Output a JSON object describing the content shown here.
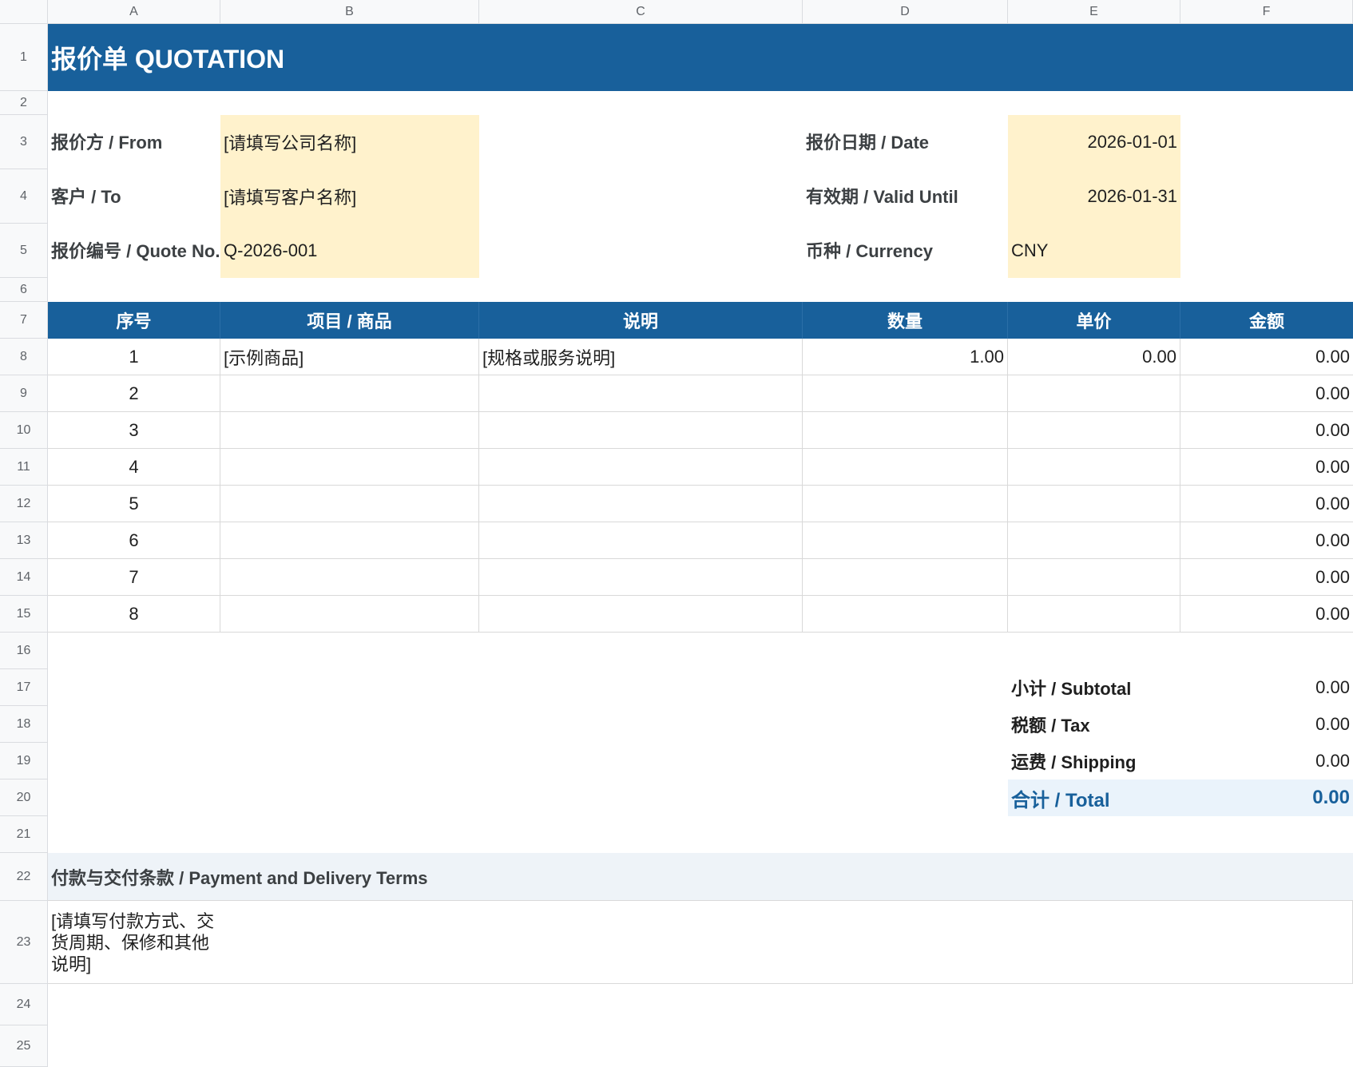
{
  "columns": [
    "A",
    "B",
    "C",
    "D",
    "E",
    "F"
  ],
  "rows": [
    "1",
    "2",
    "3",
    "4",
    "5",
    "6",
    "7",
    "8",
    "9",
    "10",
    "11",
    "12",
    "13",
    "14",
    "15",
    "16",
    "17",
    "18",
    "19",
    "20",
    "21",
    "22",
    "23",
    "24",
    "25"
  ],
  "title": "报价单 QUOTATION",
  "info": {
    "from_label": "报价方 / From",
    "from_value": "[请填写公司名称]",
    "to_label": "客户 / To",
    "to_value": "[请填写客户名称]",
    "quote_no_label": "报价编号 / Quote No.",
    "quote_no_value": "Q-2026-001",
    "date_label": "报价日期 / Date",
    "date_value": "2026-01-01",
    "valid_label": "有效期 / Valid Until",
    "valid_value": "2026-01-31",
    "currency_label": "币种 / Currency",
    "currency_value": "CNY"
  },
  "table": {
    "headers": [
      "序号",
      "项目 / 商品",
      "说明",
      "数量",
      "单价",
      "金额"
    ],
    "rows": [
      {
        "no": "1",
        "item": "[示例商品]",
        "desc": "[规格或服务说明]",
        "qty": "1.00",
        "price": "0.00",
        "amount": "0.00"
      },
      {
        "no": "2",
        "item": "",
        "desc": "",
        "qty": "",
        "price": "",
        "amount": "0.00"
      },
      {
        "no": "3",
        "item": "",
        "desc": "",
        "qty": "",
        "price": "",
        "amount": "0.00"
      },
      {
        "no": "4",
        "item": "",
        "desc": "",
        "qty": "",
        "price": "",
        "amount": "0.00"
      },
      {
        "no": "5",
        "item": "",
        "desc": "",
        "qty": "",
        "price": "",
        "amount": "0.00"
      },
      {
        "no": "6",
        "item": "",
        "desc": "",
        "qty": "",
        "price": "",
        "amount": "0.00"
      },
      {
        "no": "7",
        "item": "",
        "desc": "",
        "qty": "",
        "price": "",
        "amount": "0.00"
      },
      {
        "no": "8",
        "item": "",
        "desc": "",
        "qty": "",
        "price": "",
        "amount": "0.00"
      }
    ]
  },
  "summary": {
    "subtotal_label": "小计 / Subtotal",
    "subtotal_value": "0.00",
    "tax_label": "税额 / Tax",
    "tax_value": "0.00",
    "shipping_label": "运费 / Shipping",
    "shipping_value": "0.00",
    "total_label": "合计 / Total",
    "total_value": "0.00"
  },
  "terms": {
    "label": "付款与交付条款 / Payment and Delivery Terms",
    "body": "[请填写付款方式、交\n货周期、保修和其他\n说明]"
  },
  "colors": {
    "header_blue": "#18609b",
    "input_yellow": "#fff2cc",
    "total_bg": "#eaf3fb",
    "terms_bg": "#eef3f8"
  }
}
